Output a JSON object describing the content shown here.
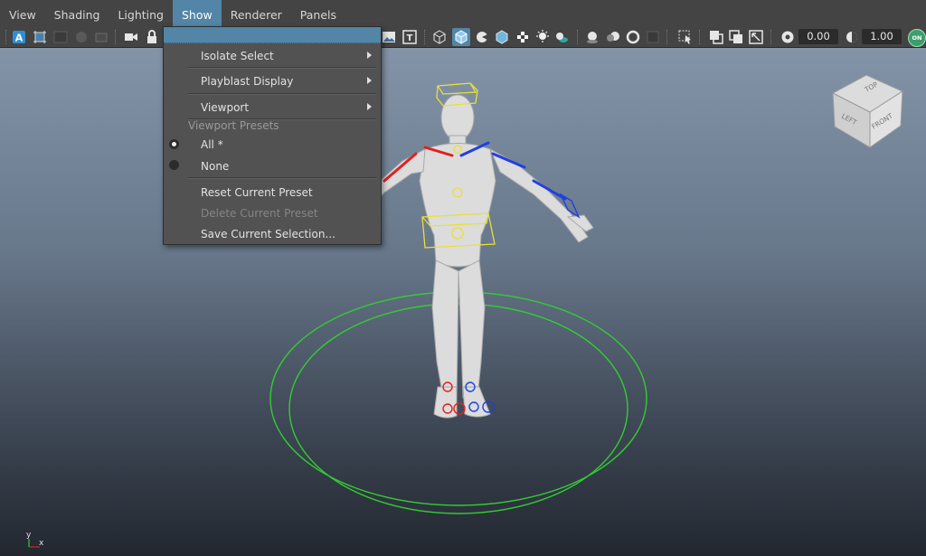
{
  "menubar": {
    "items": [
      "View",
      "Shading",
      "Lighting",
      "Show",
      "Renderer",
      "Panels"
    ],
    "active": "Show"
  },
  "toolbar": {
    "field_1": "0.00",
    "field_2": "1.00",
    "toggle_label": "ON",
    "text_icon_a": "A",
    "text_icon_t": "T"
  },
  "show_menu": {
    "isolate_select": "Isolate Select",
    "playblast_display": "Playblast Display",
    "viewport": "Viewport",
    "viewport_presets_label": "Viewport Presets",
    "preset_all": "All *",
    "preset_none": "None",
    "selected_preset": "All *",
    "reset_current_preset": "Reset Current Preset",
    "delete_current_preset": "Delete Current Preset",
    "save_current_selection": "Save Current Selection..."
  },
  "viewcube": {
    "top": "TOP",
    "left": "LEFT",
    "front": "FRONT"
  },
  "axis": {
    "y": "y",
    "x": "x"
  },
  "colors": {
    "accent": "#5285a6",
    "ik_left": "#e02020",
    "ik_right": "#2040e0",
    "controller_root": "#33cc33",
    "controller_yellow": "#e8e03a"
  }
}
